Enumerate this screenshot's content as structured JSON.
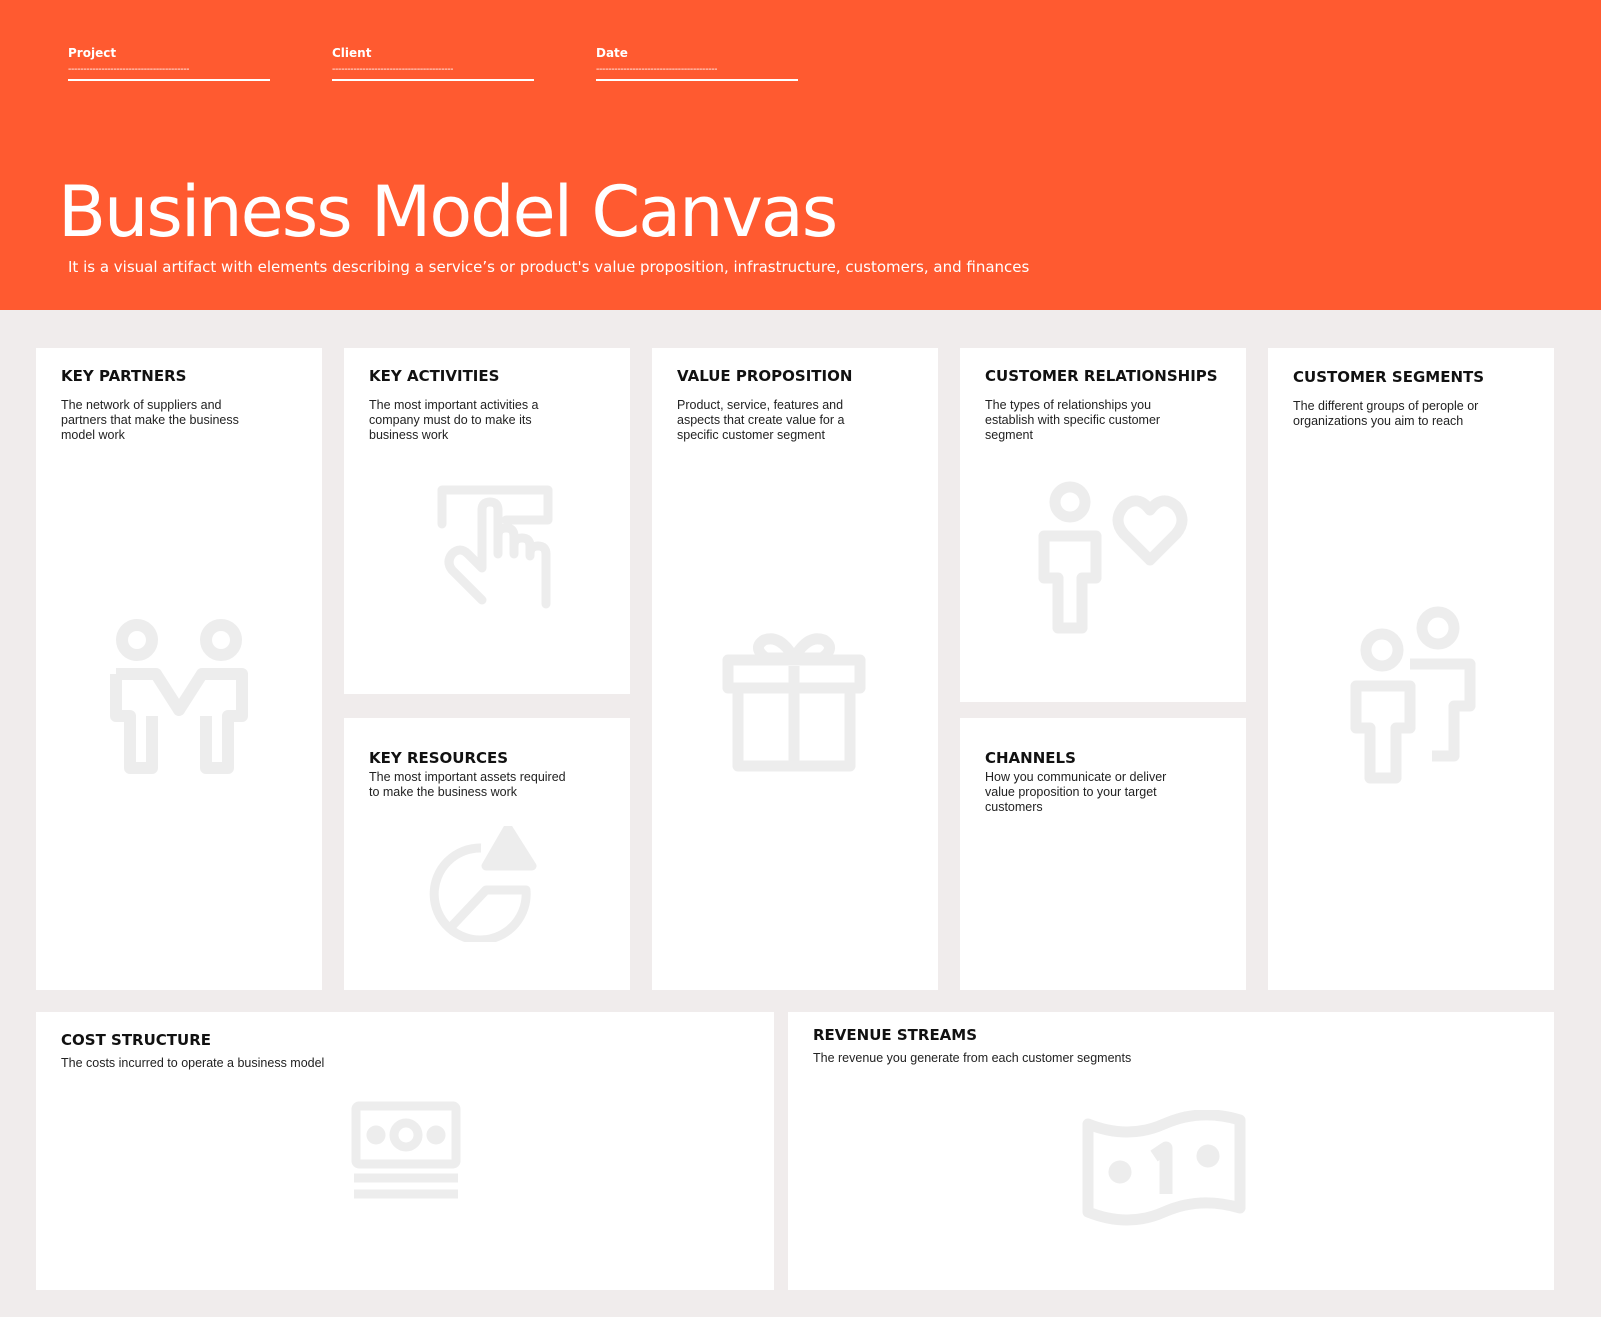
{
  "header": {
    "fields": {
      "project": {
        "label": "Project",
        "value": "----------------------------------------"
      },
      "client": {
        "label": "Client",
        "value": "----------------------------------------"
      },
      "date": {
        "label": "Date",
        "value": "----------------------------------------"
      }
    },
    "title": "Business Model Canvas",
    "subtitle": "It is a visual artifact with elements describing a service’s or product's value proposition, infrastructure, customers, and finances"
  },
  "sections": {
    "key_partners": {
      "title": "KEY PARTNERS",
      "lines": [
        "The network of suppliers and",
        "partners that make the business",
        "model work"
      ],
      "icon": "partners-icon"
    },
    "key_activities": {
      "title": "KEY ACTIVITIES",
      "lines": [
        "The most important activities a",
        "company must do to make its",
        "business work"
      ],
      "icon": "touch-screen-icon"
    },
    "key_resources": {
      "title": "KEY RESOURCES",
      "lines": [
        "The most important assets required",
        "to make the business work"
      ],
      "icon": "shapes-icon"
    },
    "value_proposition": {
      "title": "VALUE PROPOSITION",
      "lines": [
        "Product, service, features and",
        "aspects that create value for a",
        "specific customer segment"
      ],
      "icon": "gift-icon"
    },
    "customer_relationships": {
      "title": "CUSTOMER RELATIONSHIPS",
      "lines": [
        "The types of relationships you",
        "establish with specific customer",
        "segment"
      ],
      "icon": "person-heart-icon"
    },
    "channels": {
      "title": "CHANNELS",
      "lines": [
        "How you communicate or deliver",
        "value proposition to your target",
        "customers"
      ],
      "icon": ""
    },
    "customer_segments": {
      "title": "CUSTOMER SEGMENTS",
      "lines": [
        "The different groups of perople or",
        "organizations you aim to reach"
      ],
      "icon": "people-group-icon"
    },
    "cost_structure": {
      "title": "COST STRUCTURE",
      "lines": [
        "The costs incurred to operate a business model"
      ],
      "icon": "cash-stack-icon"
    },
    "revenue_streams": {
      "title": "REVENUE STREAMS",
      "lines": [
        "The revenue you generate from each customer segments"
      ],
      "icon": "banknote-icon"
    }
  },
  "colors": {
    "header": "#ff5a30",
    "background": "#f0ecec",
    "card": "#ffffff",
    "icon": "#ededed"
  }
}
